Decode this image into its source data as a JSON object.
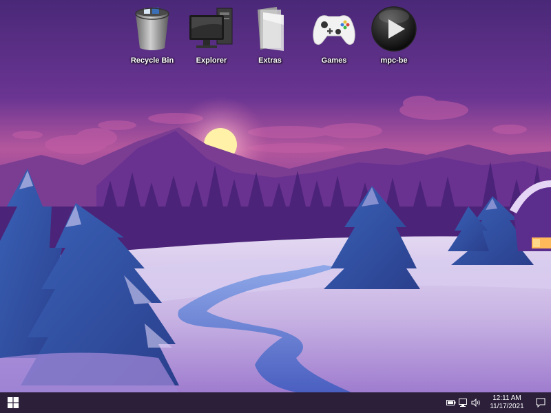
{
  "desktop": {
    "wallpaper": "winter-night-landscape",
    "icons": [
      {
        "label": "Recycle Bin",
        "icon": "recycle-bin-icon"
      },
      {
        "label": "Explorer",
        "icon": "computer-icon"
      },
      {
        "label": "Extras",
        "icon": "folder-icon"
      },
      {
        "label": "Games",
        "icon": "gamepad-icon"
      },
      {
        "label": "mpc-be",
        "icon": "play-icon"
      }
    ]
  },
  "taskbar": {
    "start_icon": "windows-logo-icon",
    "tray": {
      "icons": [
        "battery-icon",
        "network-icon",
        "volume-icon"
      ],
      "time": "12:11 AM",
      "date": "11/17/2021",
      "notification_icon": "action-center-icon"
    }
  },
  "colors": {
    "taskbar": "#2b1f3a",
    "sky_top": "#4e2a7e",
    "sky_glow": "#d06aa8",
    "snow": "#c8b6e2"
  }
}
